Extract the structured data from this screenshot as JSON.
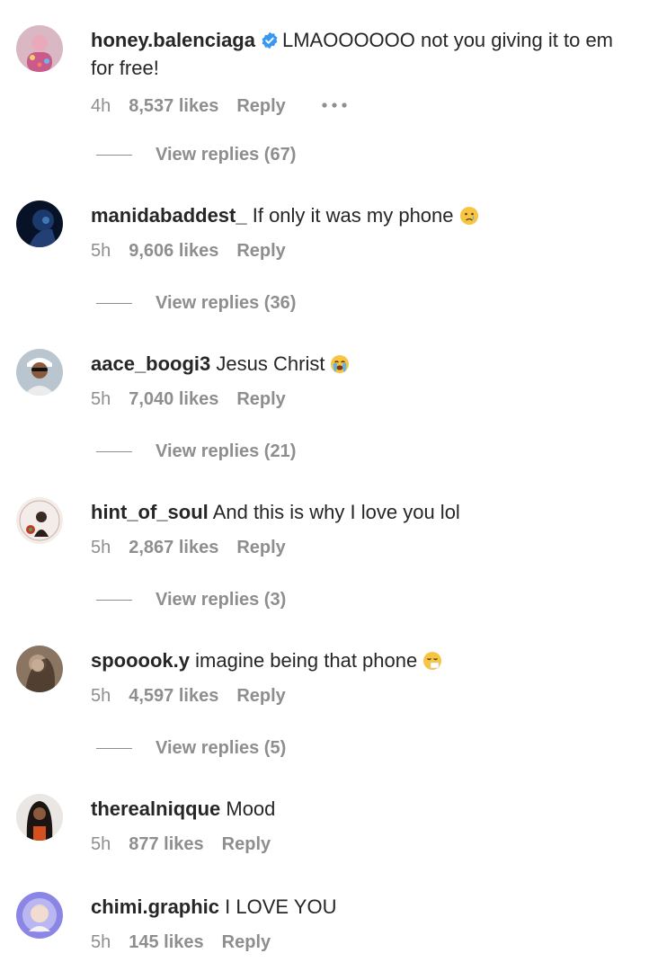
{
  "comments": [
    {
      "username": "honey.balenciaga",
      "verified": true,
      "text": "LMAOOOOOO not you giving it to em for free!",
      "time": "4h",
      "likes": "8,537 likes",
      "reply": "Reply",
      "more": "•••",
      "view_replies": "View replies (67)"
    },
    {
      "username": "manidabaddest_",
      "text": "If only it was my phone",
      "emoji": "crying-face-icon",
      "time": "5h",
      "likes": "9,606 likes",
      "reply": "Reply",
      "view_replies": "View replies (36)"
    },
    {
      "username": "aace_boogi3",
      "text": "Jesus Christ",
      "emoji": "loudly-crying-face-icon",
      "time": "5h",
      "likes": "7,040 likes",
      "reply": "Reply",
      "view_replies": "View replies (21)"
    },
    {
      "username": "hint_of_soul",
      "text": "And this is why I love you lol",
      "time": "5h",
      "likes": "2,867 likes",
      "reply": "Reply",
      "view_replies": "View replies (3)"
    },
    {
      "username": "spooook.y",
      "text": "imagine being that phone",
      "emoji": "sneezing-face-icon",
      "time": "5h",
      "likes": "4,597 likes",
      "reply": "Reply",
      "view_replies": "View replies (5)"
    },
    {
      "username": "therealniqque",
      "text": "Mood",
      "time": "5h",
      "likes": "877 likes",
      "reply": "Reply"
    },
    {
      "username": "chimi.graphic",
      "text": "I LOVE YOU",
      "time": "5h",
      "likes": "145 likes",
      "reply": "Reply"
    }
  ],
  "colors": {
    "text": "#262626",
    "secondary": "#8e8e8e",
    "verified": "#3897f0"
  }
}
